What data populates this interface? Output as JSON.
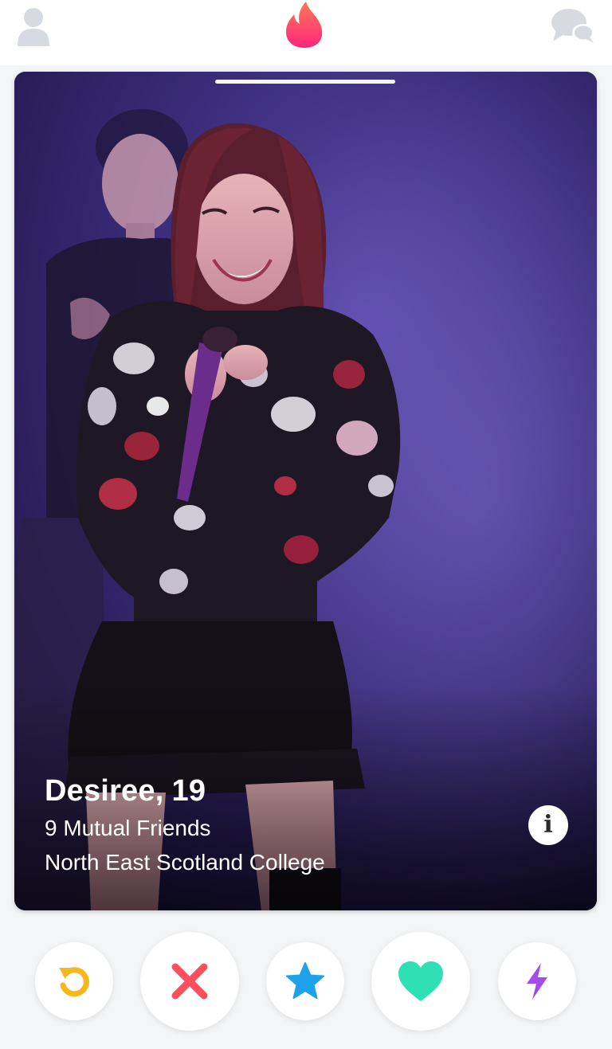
{
  "header": {
    "left_icon": "profile-icon",
    "center_icon": "flame-logo-icon",
    "right_icon": "messages-icon"
  },
  "card": {
    "name": "Desiree,",
    "age": "19",
    "mutual_friends": "9 Mutual Friends",
    "school": "North East Scotland College",
    "info_label": "i",
    "photo_count_indicator": 1
  },
  "actions": [
    {
      "name": "rewind",
      "icon": "rewind-icon",
      "color": "#f5b81c"
    },
    {
      "name": "nope",
      "icon": "close-icon",
      "color": "#fd4e5d"
    },
    {
      "name": "super-like",
      "icon": "star-icon",
      "color": "#1fa1ea"
    },
    {
      "name": "like",
      "icon": "heart-icon",
      "color": "#2ee0b4"
    },
    {
      "name": "boost",
      "icon": "bolt-icon",
      "color": "#a44be9"
    }
  ],
  "colors": {
    "brand": "#fd5068",
    "inactive_icon": "#d7dbe1"
  }
}
